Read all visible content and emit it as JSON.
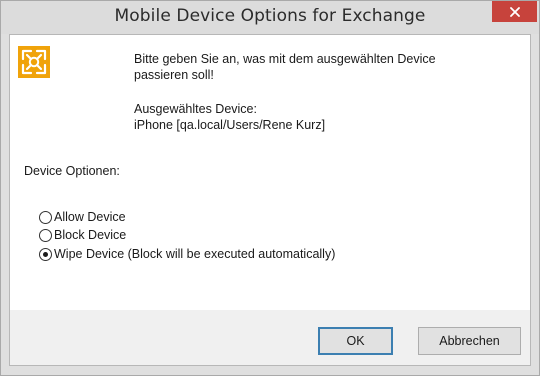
{
  "window": {
    "title": "Mobile Device Options for Exchange",
    "close_icon": "close-icon",
    "accent_color": "#c7433c"
  },
  "message": {
    "icon": "exchange-logo-icon",
    "icon_color": "#f0a30a",
    "line1": "Bitte geben Sie an, was mit dem ausgewählten Device",
    "line2": "passieren soll!",
    "selected_label": "Ausgewähltes Device:",
    "selected_value": "iPhone [qa.local/Users/Rene Kurz]"
  },
  "options": {
    "heading": "Device Optionen:",
    "items": [
      {
        "label": "Allow Device",
        "checked": false
      },
      {
        "label": "Block Device",
        "checked": false
      },
      {
        "label": "Wipe Device (Block will be executed automatically)",
        "checked": true
      }
    ]
  },
  "buttons": {
    "ok_label": "OK",
    "cancel_label": "Abbrechen"
  }
}
